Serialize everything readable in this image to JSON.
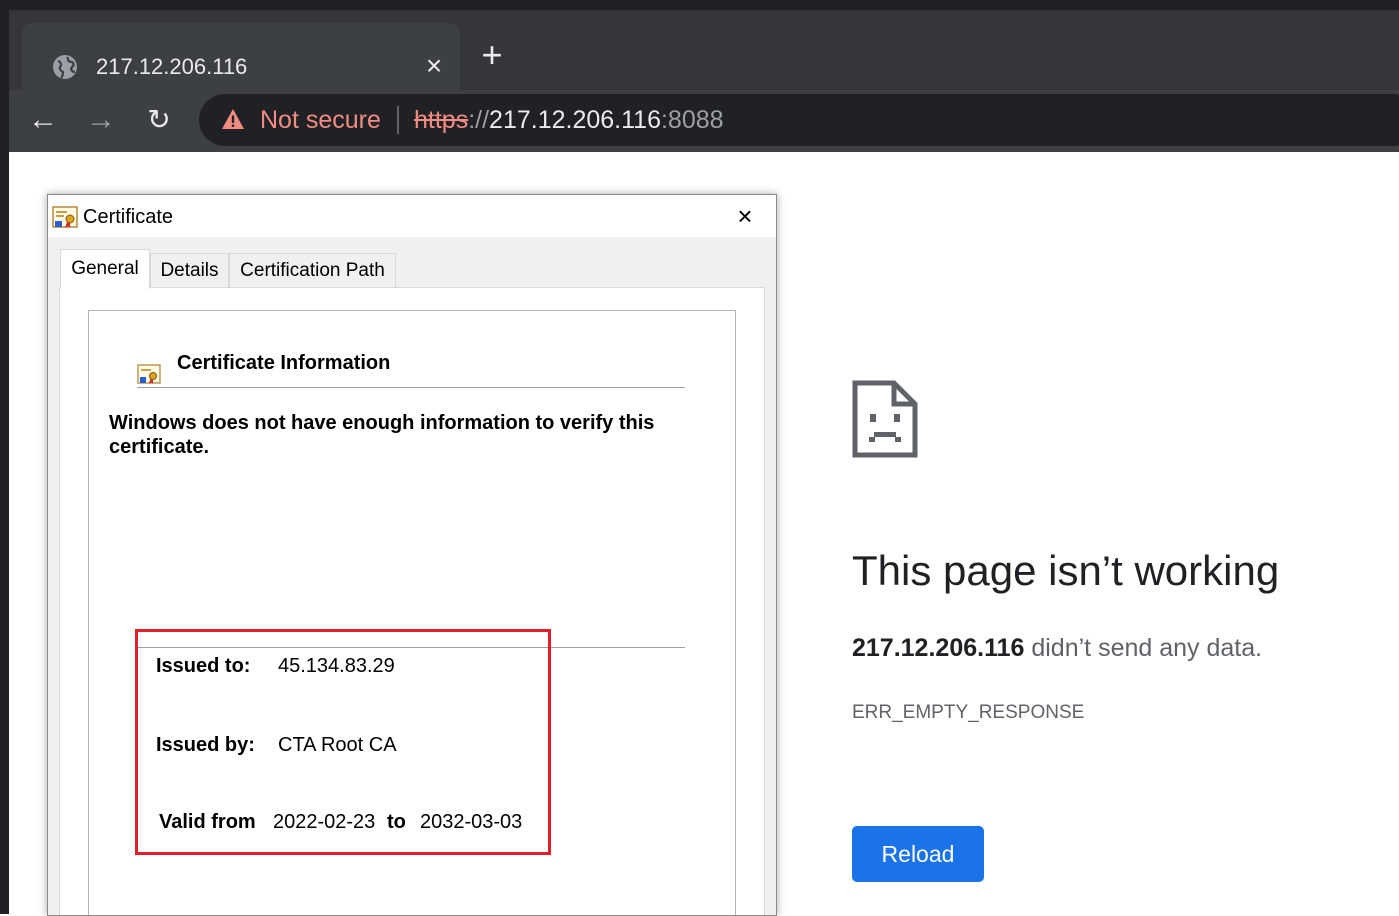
{
  "browser": {
    "tab": {
      "title": "217.12.206.116",
      "icon": "globe-icon",
      "close_glyph": "×"
    },
    "new_tab_glyph": "+",
    "nav": {
      "back_glyph": "←",
      "forward_glyph": "→",
      "reload_glyph": "↻"
    },
    "omnibox": {
      "security_label": "Not secure",
      "url_scheme": "https",
      "url_separator": "://",
      "url_host": "217.12.206.116",
      "url_port": ":8088"
    },
    "colors": {
      "warning": "#f28b82",
      "chrome_dark": "#202124",
      "toolbar": "#3c4043"
    }
  },
  "error_page": {
    "icon": "sad-page-icon",
    "title": "This page isn’t working",
    "host": "217.12.206.116",
    "message": " didn’t send any data.",
    "code": "ERR_EMPTY_RESPONSE",
    "reload_label": "Reload",
    "accent": "#1a73e8"
  },
  "certificate_dialog": {
    "title": "Certificate",
    "close_glyph": "×",
    "tabs": [
      {
        "label": "General",
        "active": true
      },
      {
        "label": "Details",
        "active": false
      },
      {
        "label": "Certification Path",
        "active": false
      }
    ],
    "info_heading": "Certificate Information",
    "warning": "Windows does not have enough information to verify this certificate.",
    "issued_to_label": "Issued to:",
    "issued_to": "45.134.83.29",
    "issued_by_label": "Issued by:",
    "issued_by": "CTA Root CA",
    "valid_from_label": "Valid from",
    "valid_from": "2022-02-23",
    "to_label": "to",
    "valid_to": "2032-03-03",
    "highlight_color": "#e0202a"
  }
}
